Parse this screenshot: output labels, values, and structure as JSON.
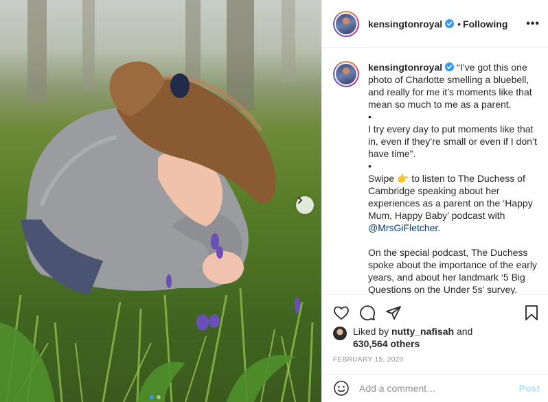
{
  "post": {
    "username": "kensingtonroyal",
    "separator": "•",
    "follow_status": "Following",
    "more_label": "•••"
  },
  "caption": {
    "username": "kensingtonroyal",
    "lines": [
      "“I’ve got this one photo of Charlotte smelling a bluebell, and really for me it’s moments like that mean so much to me as a parent.",
      "•",
      "I try every day to put moments like that in, even if they’re small or even if I don’t have time”.",
      "•"
    ],
    "swipe_prefix": "Swipe",
    "swipe_emoji": "👉",
    "swipe_text": "to listen to The Duchess of Cambridge speaking about her experiences as a parent on the ‘Happy Mum, Happy Baby’ podcast with",
    "mention": "@MrsGiFletcher",
    "mention_suffix": ".",
    "more_text": "On the special podcast, The Duchess spoke about the importance of the early years, and about her landmark ‘5 Big Questions on the Under 5s’ survey."
  },
  "likes": {
    "prefix": "Liked by",
    "liker": "nutty_nafisah",
    "and": "and",
    "count": "630,564 others"
  },
  "date": "FEBRUARY 15, 2020",
  "comment_box": {
    "placeholder": "Add a comment…",
    "post_label": "Post"
  },
  "icons": {
    "like": "heart-icon",
    "comment": "comment-icon",
    "share": "share-icon",
    "save": "bookmark-icon",
    "emoji": "emoji-icon",
    "next": "chevron-right-icon",
    "verified": "verified-badge-icon"
  },
  "colors": {
    "verified": "#3897f0",
    "mention": "#00376b",
    "muted": "#8e8e8e",
    "post_disabled": "#b2dffc",
    "carousel_active_dot": "#3897f0"
  },
  "carousel": {
    "slide_count": 2,
    "active_index": 0
  }
}
